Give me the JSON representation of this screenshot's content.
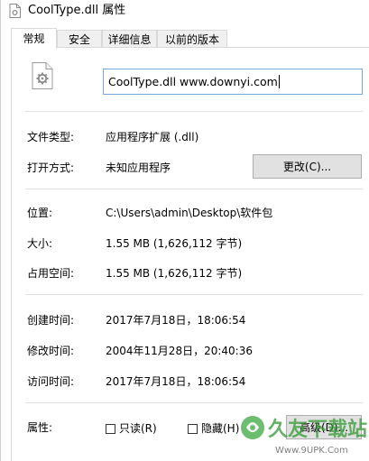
{
  "window": {
    "title": "CoolType.dll 属性"
  },
  "tabs": [
    {
      "label": "常规",
      "active": true
    },
    {
      "label": "安全",
      "active": false
    },
    {
      "label": "详细信息",
      "active": false
    },
    {
      "label": "以前的版本",
      "active": false
    }
  ],
  "general": {
    "file_name": "CoolType.dll www.downyi.com",
    "file_type_label": "文件类型:",
    "file_type_value": "应用程序扩展 (.dll)",
    "open_with_label": "打开方式:",
    "open_with_value": "未知应用程序",
    "change_button": "更改(C)...",
    "location_label": "位置:",
    "location_value": "C:\\Users\\admin\\Desktop\\软件包",
    "size_label": "大小:",
    "size_value": "1.55 MB (1,626,112 字节)",
    "size_on_disk_label": "占用空间:",
    "size_on_disk_value": "1.55 MB (1,626,112 字节)",
    "created_label": "创建时间:",
    "created_value": "2017年7月18日，18:06:54",
    "modified_label": "修改时间:",
    "modified_value": "2004年11月28日，20:40:36",
    "accessed_label": "访问时间:",
    "accessed_value": "2017年7月18日，18:06:54",
    "attributes_label": "属性:",
    "readonly_label": "只读(R)",
    "readonly_checked": false,
    "hidden_label": "隐藏(H)",
    "hidden_checked": false,
    "advanced_button": "高级(D)..."
  },
  "watermark": {
    "brand": "久友下载站",
    "url": "Www.9UPK.Com"
  },
  "colors": {
    "input_border": "#7aa7d9",
    "button_face": "#e1e1e1",
    "watermark_green": "#3a9a3a"
  },
  "icons": {
    "title_icon": "dll-file-icon",
    "file_icon": "dll-gear-file-icon"
  }
}
